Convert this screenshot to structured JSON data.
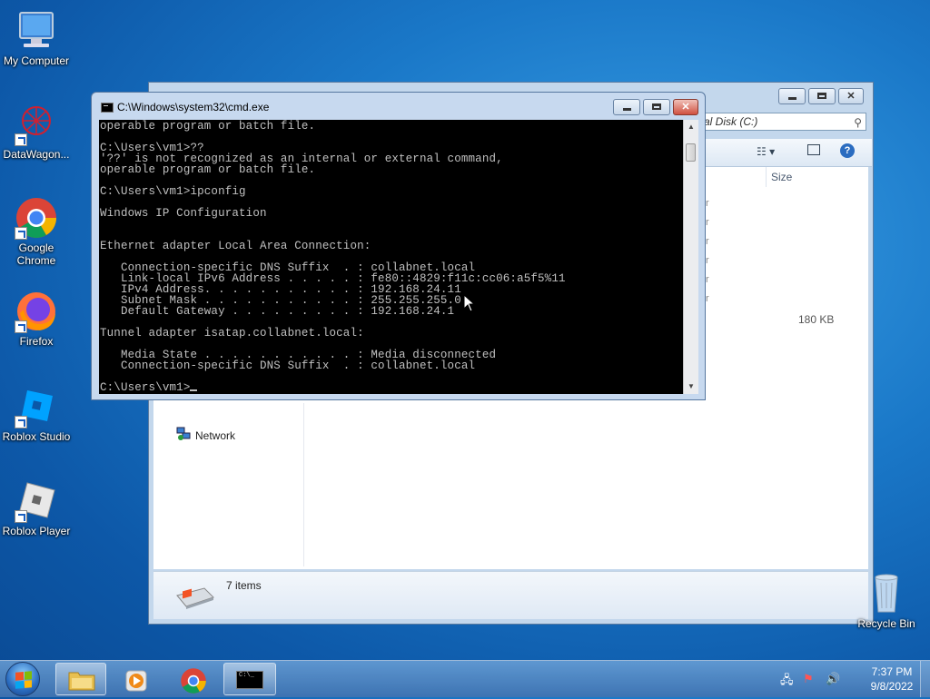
{
  "desktop": {
    "icons": [
      {
        "label": "My Computer"
      },
      {
        "label": "DataWagon..."
      },
      {
        "label": "Google Chrome"
      },
      {
        "label": "Firefox"
      },
      {
        "label": "Roblox Studio"
      },
      {
        "label": "Roblox Player"
      },
      {
        "label": "Recycle Bin"
      }
    ]
  },
  "explorer": {
    "address_text": "al Disk (C:)",
    "column_size": "Size",
    "row_stub": "r",
    "file_size": "180 KB",
    "nav_network": "Network",
    "status_items": "7 items"
  },
  "cmd": {
    "title": "C:\\Windows\\system32\\cmd.exe",
    "lines": [
      "operable program or batch file.",
      "",
      "C:\\Users\\vm1>??",
      "'??' is not recognized as an internal or external command,",
      "operable program or batch file.",
      "",
      "C:\\Users\\vm1>ipconfig",
      "",
      "Windows IP Configuration",
      "",
      "",
      "Ethernet adapter Local Area Connection:",
      "",
      "   Connection-specific DNS Suffix  . : collabnet.local",
      "   Link-local IPv6 Address . . . . . : fe80::4829:f11c:cc06:a5f5%11",
      "   IPv4 Address. . . . . . . . . . . : 192.168.24.11",
      "   Subnet Mask . . . . . . . . . . . : 255.255.255.0",
      "   Default Gateway . . . . . . . . . : 192.168.24.1",
      "",
      "Tunnel adapter isatap.collabnet.local:",
      "",
      "   Media State . . . . . . . . . . . : Media disconnected",
      "   Connection-specific DNS Suffix  . : collabnet.local",
      "",
      "C:\\Users\\vm1>"
    ]
  },
  "taskbar": {
    "time": "7:37 PM",
    "date": "9/8/2022"
  }
}
